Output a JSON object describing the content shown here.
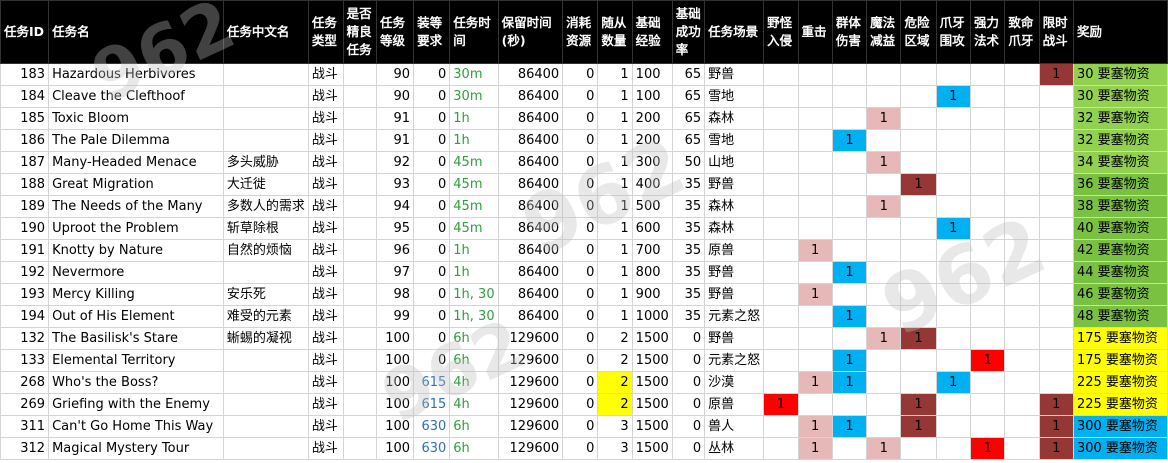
{
  "headers": [
    "任务ID",
    "任务名",
    "任务中文名",
    "任务类型",
    "是否精良任务",
    "任务等级",
    "装等要求",
    "任务时间",
    "保留时间(秒)",
    "消耗资源",
    "随从数量",
    "基础经验",
    "基础成功率",
    "任务场景",
    "野怪入侵",
    "重击",
    "群体伤害",
    "魔法减益",
    "危险区域",
    "爪牙围攻",
    "强力法术",
    "致命爪牙",
    "限时战斗",
    "奖励"
  ],
  "rows": [
    {
      "id": "183",
      "name": "Hazardous Herbivores",
      "cn": "",
      "type": "战斗",
      "elite": "",
      "level": "90",
      "ilvl": "0",
      "time": "30m",
      "keep": "86400",
      "cost": "0",
      "followers": "1",
      "xp": "100",
      "rate": "65",
      "scene": "野兽",
      "wild": "",
      "crit": "",
      "aoe": "",
      "magic": "",
      "danger": "",
      "minion": "",
      "spell": "",
      "deadly": "",
      "timed": "1",
      "reward": "30 要塞物资"
    },
    {
      "id": "184",
      "name": "Cleave the Clefthoof",
      "cn": "",
      "type": "战斗",
      "elite": "",
      "level": "90",
      "ilvl": "0",
      "time": "30m",
      "keep": "86400",
      "cost": "0",
      "followers": "1",
      "xp": "100",
      "rate": "65",
      "scene": "雪地",
      "wild": "",
      "crit": "",
      "aoe": "",
      "magic": "",
      "danger": "",
      "minion": "1",
      "spell": "",
      "deadly": "",
      "timed": "",
      "reward": "30 要塞物资"
    },
    {
      "id": "185",
      "name": "Toxic Bloom",
      "cn": "",
      "type": "战斗",
      "elite": "",
      "level": "91",
      "ilvl": "0",
      "time": "1h",
      "keep": "86400",
      "cost": "0",
      "followers": "1",
      "xp": "200",
      "rate": "65",
      "scene": "森林",
      "wild": "",
      "crit": "",
      "aoe": "",
      "magic": "1",
      "danger": "",
      "minion": "",
      "spell": "",
      "deadly": "",
      "timed": "",
      "reward": "32 要塞物资"
    },
    {
      "id": "186",
      "name": "The Pale Dilemma",
      "cn": "",
      "type": "战斗",
      "elite": "",
      "level": "91",
      "ilvl": "0",
      "time": "1h",
      "keep": "86400",
      "cost": "0",
      "followers": "1",
      "xp": "200",
      "rate": "65",
      "scene": "雪地",
      "wild": "",
      "crit": "",
      "aoe": "1",
      "magic": "",
      "danger": "",
      "minion": "",
      "spell": "",
      "deadly": "",
      "timed": "",
      "reward": "32 要塞物资"
    },
    {
      "id": "187",
      "name": "Many-Headed Menace",
      "cn": "多头威胁",
      "type": "战斗",
      "elite": "",
      "level": "92",
      "ilvl": "0",
      "time": "45m",
      "keep": "86400",
      "cost": "0",
      "followers": "1",
      "xp": "300",
      "rate": "50",
      "scene": "山地",
      "wild": "",
      "crit": "",
      "aoe": "",
      "magic": "1",
      "danger": "",
      "minion": "",
      "spell": "",
      "deadly": "",
      "timed": "",
      "reward": "34 要塞物资"
    },
    {
      "id": "188",
      "name": "Great Migration",
      "cn": "大迁徙",
      "type": "战斗",
      "elite": "",
      "level": "93",
      "ilvl": "0",
      "time": "45m",
      "keep": "86400",
      "cost": "0",
      "followers": "1",
      "xp": "400",
      "rate": "35",
      "scene": "野兽",
      "wild": "",
      "crit": "",
      "aoe": "",
      "magic": "",
      "danger": "1",
      "minion": "",
      "spell": "",
      "deadly": "",
      "timed": "",
      "reward": "36 要塞物资"
    },
    {
      "id": "189",
      "name": "The Needs of the Many",
      "cn": "多数人的需求",
      "type": "战斗",
      "elite": "",
      "level": "94",
      "ilvl": "0",
      "time": "45m",
      "keep": "86400",
      "cost": "0",
      "followers": "1",
      "xp": "500",
      "rate": "35",
      "scene": "森林",
      "wild": "",
      "crit": "",
      "aoe": "",
      "magic": "1",
      "danger": "",
      "minion": "",
      "spell": "",
      "deadly": "",
      "timed": "",
      "reward": "38 要塞物资"
    },
    {
      "id": "190",
      "name": "Uproot the Problem",
      "cn": "斩草除根",
      "type": "战斗",
      "elite": "",
      "level": "95",
      "ilvl": "0",
      "time": "45m",
      "keep": "86400",
      "cost": "0",
      "followers": "1",
      "xp": "600",
      "rate": "35",
      "scene": "森林",
      "wild": "",
      "crit": "",
      "aoe": "",
      "magic": "",
      "danger": "",
      "minion": "1",
      "spell": "",
      "deadly": "",
      "timed": "",
      "reward": "40 要塞物资"
    },
    {
      "id": "191",
      "name": "Knotty by Nature",
      "cn": "自然的烦恼",
      "type": "战斗",
      "elite": "",
      "level": "96",
      "ilvl": "0",
      "time": "1h",
      "keep": "86400",
      "cost": "0",
      "followers": "1",
      "xp": "700",
      "rate": "35",
      "scene": "原兽",
      "wild": "",
      "crit": "1",
      "aoe": "",
      "magic": "",
      "danger": "",
      "minion": "",
      "spell": "",
      "deadly": "",
      "timed": "",
      "reward": "42 要塞物资"
    },
    {
      "id": "192",
      "name": "Nevermore",
      "cn": "",
      "type": "战斗",
      "elite": "",
      "level": "97",
      "ilvl": "0",
      "time": "1h",
      "keep": "86400",
      "cost": "0",
      "followers": "1",
      "xp": "800",
      "rate": "35",
      "scene": "野兽",
      "wild": "",
      "crit": "",
      "aoe": "1",
      "magic": "",
      "danger": "",
      "minion": "",
      "spell": "",
      "deadly": "",
      "timed": "",
      "reward": "44 要塞物资"
    },
    {
      "id": "193",
      "name": "Mercy Killing",
      "cn": "安乐死",
      "type": "战斗",
      "elite": "",
      "level": "98",
      "ilvl": "0",
      "time": "1h, 30",
      "keep": "86400",
      "cost": "0",
      "followers": "1",
      "xp": "900",
      "rate": "35",
      "scene": "野兽",
      "wild": "",
      "crit": "1",
      "aoe": "",
      "magic": "",
      "danger": "",
      "minion": "",
      "spell": "",
      "deadly": "",
      "timed": "",
      "reward": "46 要塞物资"
    },
    {
      "id": "194",
      "name": "Out of His Element",
      "cn": "难受的元素",
      "type": "战斗",
      "elite": "",
      "level": "99",
      "ilvl": "0",
      "time": "1h, 30",
      "keep": "86400",
      "cost": "0",
      "followers": "1",
      "xp": "1000",
      "rate": "35",
      "scene": "元素之怒",
      "wild": "",
      "crit": "",
      "aoe": "1",
      "magic": "",
      "danger": "",
      "minion": "",
      "spell": "",
      "deadly": "",
      "timed": "",
      "reward": "48 要塞物资"
    },
    {
      "id": "132",
      "name": "The Basilisk's Stare",
      "cn": "蜥蜴的凝视",
      "type": "战斗",
      "elite": "",
      "level": "100",
      "ilvl": "0",
      "time": "6h",
      "keep": "129600",
      "cost": "0",
      "followers": "2",
      "xp": "1500",
      "rate": "0",
      "scene": "野兽",
      "wild": "",
      "crit": "",
      "aoe": "",
      "magic": "1",
      "danger": "1",
      "minion": "",
      "spell": "",
      "deadly": "",
      "timed": "",
      "reward": "175 要塞物资"
    },
    {
      "id": "133",
      "name": "Elemental Territory",
      "cn": "",
      "type": "战斗",
      "elite": "",
      "level": "100",
      "ilvl": "0",
      "time": "6h",
      "keep": "129600",
      "cost": "0",
      "followers": "2",
      "xp": "1500",
      "rate": "0",
      "scene": "元素之怒",
      "wild": "",
      "crit": "",
      "aoe": "1",
      "magic": "",
      "danger": "",
      "minion": "",
      "spell": "1",
      "deadly": "",
      "timed": "",
      "reward": "175 要塞物资"
    },
    {
      "id": "268",
      "name": "Who's the Boss?",
      "cn": "",
      "type": "战斗",
      "elite": "",
      "level": "100",
      "ilvl": "615",
      "time": "4h",
      "keep": "129600",
      "cost": "0",
      "followers": "2",
      "xp": "1500",
      "rate": "0",
      "scene": "沙漠",
      "wild": "",
      "crit": "1",
      "aoe": "1",
      "magic": "",
      "danger": "",
      "minion": "1",
      "spell": "",
      "deadly": "",
      "timed": "",
      "reward": "225 要塞物资"
    },
    {
      "id": "269",
      "name": "Griefing with the Enemy",
      "cn": "",
      "type": "战斗",
      "elite": "",
      "level": "100",
      "ilvl": "615",
      "time": "4h",
      "keep": "129600",
      "cost": "0",
      "followers": "2",
      "xp": "1500",
      "rate": "0",
      "scene": "原兽",
      "wild": "1",
      "crit": "",
      "aoe": "",
      "magic": "",
      "danger": "1",
      "minion": "",
      "spell": "",
      "deadly": "",
      "timed": "1",
      "reward": "225 要塞物资"
    },
    {
      "id": "311",
      "name": "Can't Go Home This Way",
      "cn": "",
      "type": "战斗",
      "elite": "",
      "level": "100",
      "ilvl": "630",
      "time": "6h",
      "keep": "129600",
      "cost": "0",
      "followers": "3",
      "xp": "1500",
      "rate": "0",
      "scene": "兽人",
      "wild": "",
      "crit": "1",
      "aoe": "1",
      "magic": "",
      "danger": "1",
      "minion": "",
      "spell": "",
      "deadly": "",
      "timed": "1",
      "reward": "300 要塞物资"
    },
    {
      "id": "312",
      "name": "Magical Mystery Tour",
      "cn": "",
      "type": "战斗",
      "elite": "",
      "level": "100",
      "ilvl": "630",
      "time": "6h",
      "keep": "129600",
      "cost": "0",
      "followers": "3",
      "xp": "1500",
      "rate": "0",
      "scene": "丛林",
      "wild": "",
      "crit": "1",
      "aoe": "",
      "magic": "1",
      "danger": "",
      "minion": "",
      "spell": "1",
      "deadly": "",
      "timed": "1",
      "reward": "300 要塞物资"
    }
  ],
  "colors": {
    "header_bg": "#000000",
    "pink": "#e6b8b7",
    "maroon": "#953735",
    "blue": "#00b0f0",
    "red": "#ff0000",
    "yellow": "#ffff00",
    "green_text": "#2f9e3d",
    "blue_text": "#2e6fb6"
  }
}
